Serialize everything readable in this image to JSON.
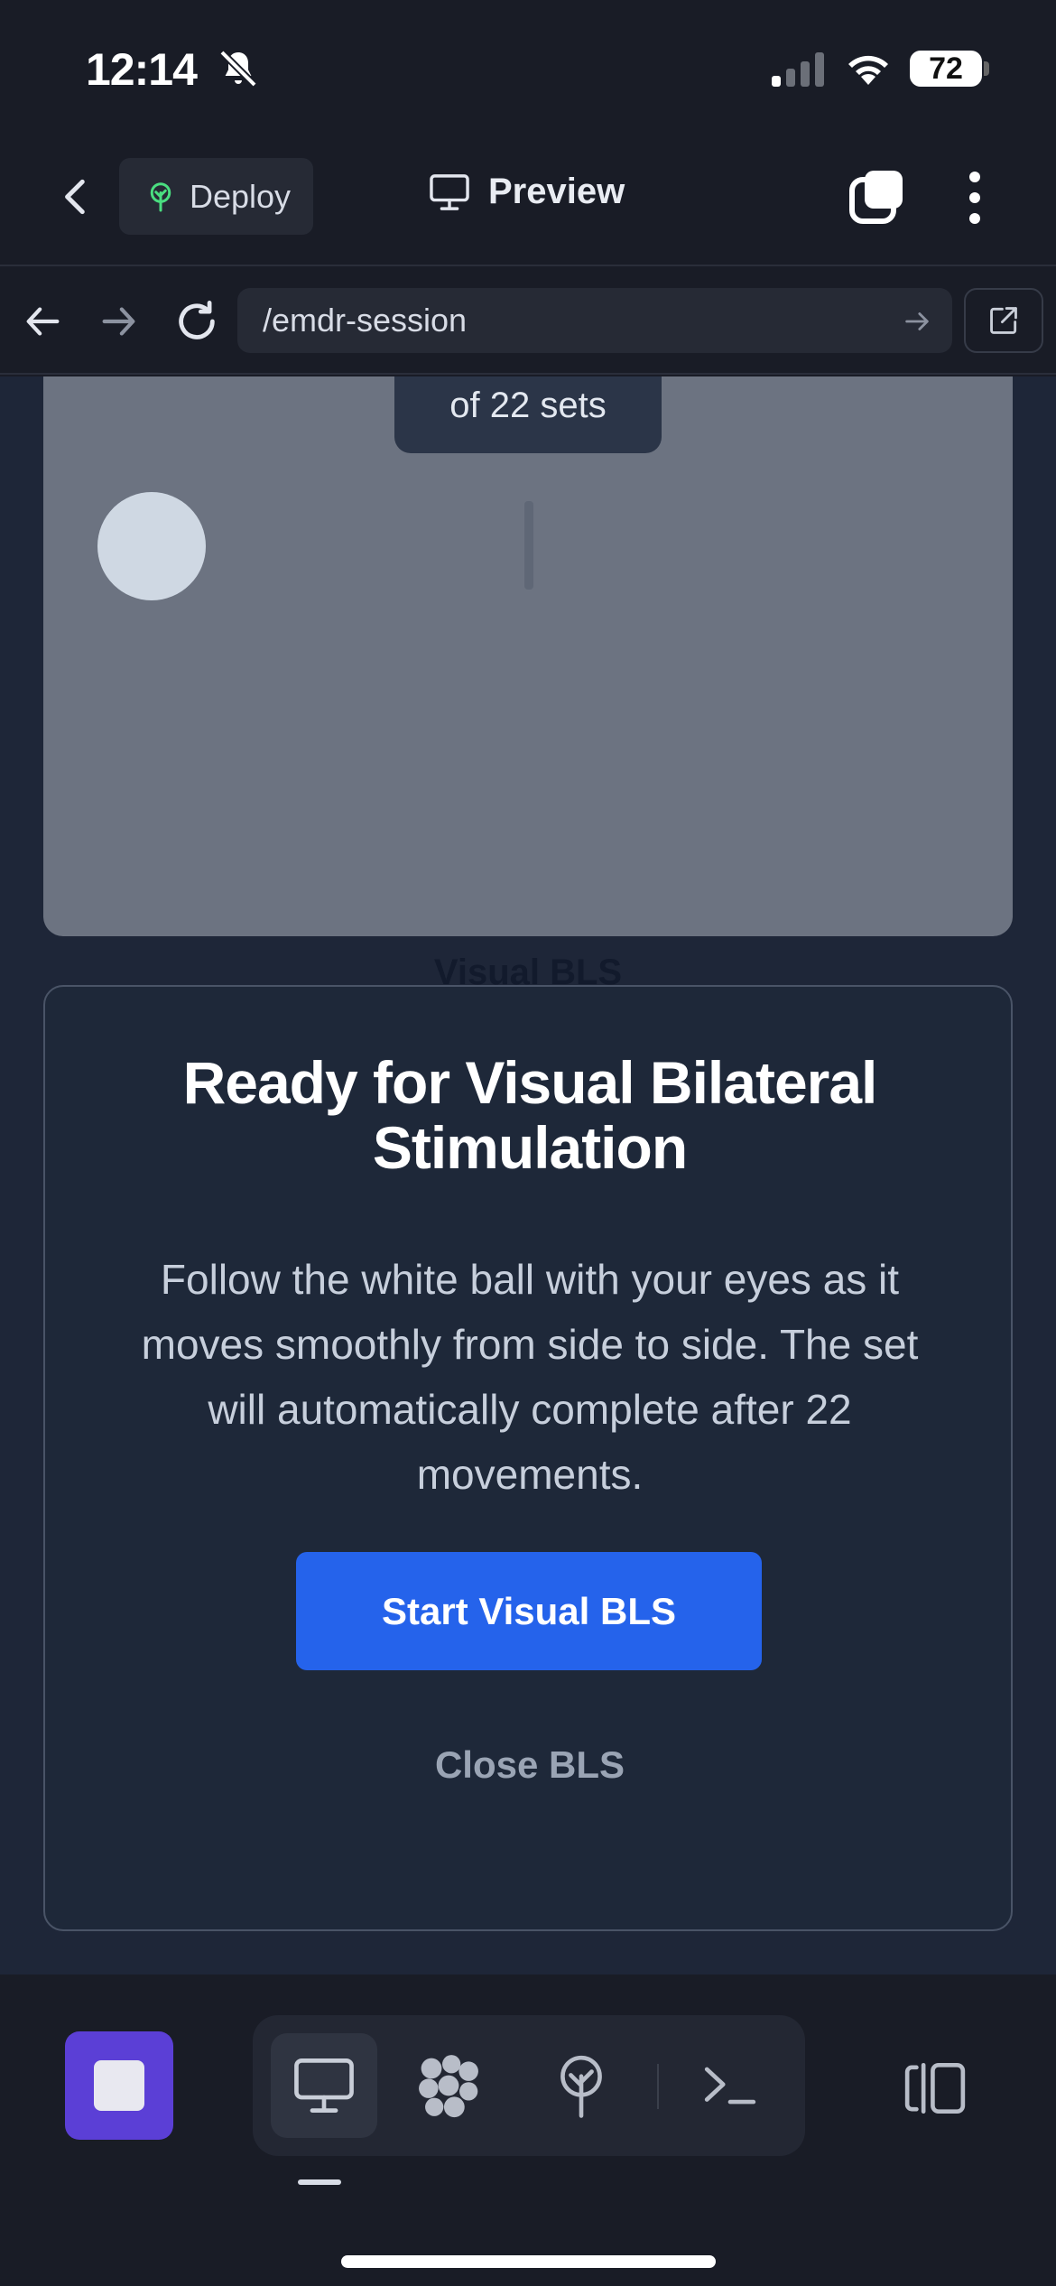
{
  "status_bar": {
    "time": "12:14",
    "battery": "72"
  },
  "app_bar": {
    "deploy_label": "Deploy",
    "preview_label": "Preview"
  },
  "url_bar": {
    "path": "/emdr-session"
  },
  "stage": {
    "sets_label": "of 22 sets"
  },
  "background_label": "Visual BLS",
  "modal": {
    "title": "Ready for Visual Bilateral Stimulation",
    "description": "Follow the white ball with your eyes as it moves smoothly from side to side. The set will automatically complete after 22 movements.",
    "start_button": "Start Visual BLS",
    "close_button": "Close BLS"
  },
  "colors": {
    "accent": "#2563eb",
    "stop": "#5b3fd6",
    "deploy_icon": "#4ade80"
  },
  "icons": [
    "bell-slash-icon",
    "cellular-signal-icon",
    "wifi-icon",
    "battery-icon",
    "chevron-left-icon",
    "deploy-tree-icon",
    "monitor-icon",
    "tabs-icon",
    "more-vertical-icon",
    "arrow-left-icon",
    "arrow-right-icon",
    "reload-icon",
    "external-link-icon",
    "stop-icon",
    "cubes-icon",
    "terminal-icon",
    "panel-toggle-icon"
  ]
}
